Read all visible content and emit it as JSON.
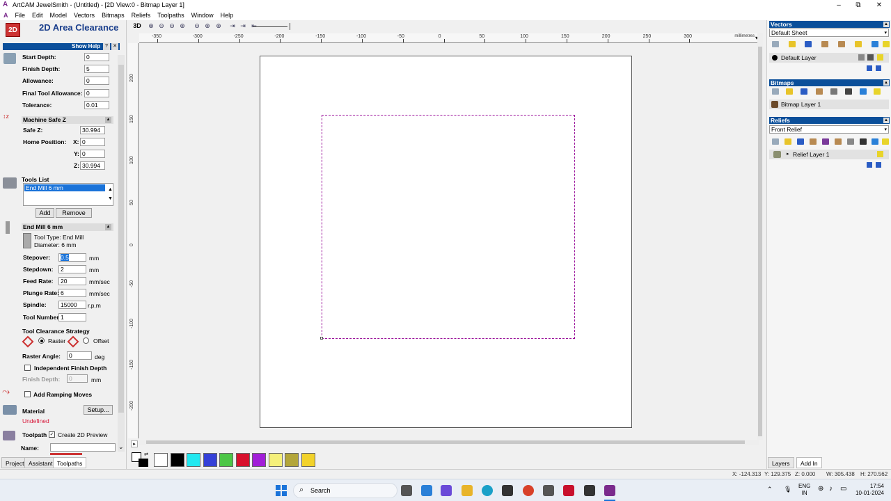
{
  "window": {
    "title": "ArtCAM JewelSmith - (Untitled) - [2D View:0 - Bitmap Layer 1]",
    "minimize": "–",
    "maximize": "⧉",
    "close": "✕"
  },
  "menu": [
    "File",
    "Edit",
    "Model",
    "Vectors",
    "Bitmaps",
    "Reliefs",
    "Toolpaths",
    "Window",
    "Help"
  ],
  "panel": {
    "title": "2D Area Clearance",
    "show_help": "Show Help",
    "start_depth_label": "Start Depth:",
    "start_depth": "0",
    "finish_depth_label": "Finish Depth:",
    "finish_depth": "5",
    "allowance_label": "Allowance:",
    "allowance": "0",
    "final_tool_allowance_label": "Final Tool Allowance:",
    "final_tool_allowance": "0",
    "tolerance_label": "Tolerance:",
    "tolerance": "0.01",
    "machine_safe_z_header": "Machine Safe Z",
    "safe_z_label": "Safe Z:",
    "safe_z": "30.994",
    "home_position_label": "Home Position:",
    "home_x_label": "X:",
    "home_x": "0",
    "home_y_label": "Y:",
    "home_y": "0",
    "home_z_label": "Z:",
    "home_z": "30.994",
    "tools_list_label": "Tools List",
    "tools": [
      "End Mill 6 mm"
    ],
    "add": "Add",
    "remove": "Remove",
    "tool_header": "End Mill 6 mm",
    "tool_type": "Tool Type: End Mill",
    "diameter": "Diameter: 6 mm",
    "stepover_label": "Stepover:",
    "stepover": "0.5",
    "stepover_unit": "mm",
    "stepdown_label": "Stepdown:",
    "stepdown": "2",
    "stepdown_unit": "mm",
    "feed_rate_label": "Feed Rate:",
    "feed_rate": "20",
    "feed_rate_unit": "mm/sec",
    "plunge_rate_label": "Plunge Rate:",
    "plunge_rate": "6",
    "plunge_rate_unit": "mm/sec",
    "spindle_label": "Spindle:",
    "spindle": "15000",
    "spindle_unit": "r.p.m",
    "tool_number_label": "Tool Number:",
    "tool_number": "1",
    "strategy_label": "Tool Clearance Strategy",
    "raster": "Raster",
    "offset": "Offset",
    "raster_angle_label": "Raster Angle:",
    "raster_angle": "0",
    "raster_angle_unit": "deg",
    "independent_finish_depth": "Independent Finish Depth",
    "finish_depth2_label": "Finish Depth:",
    "finish_depth2": "0",
    "finish_depth2_unit": "mm",
    "add_ramping_moves": "Add Ramping Moves",
    "material_label": "Material",
    "setup": "Setup...",
    "material_value": "Undefined",
    "toolpath_label": "Toolpath",
    "create_2d_preview": "Create 2D Preview",
    "name_label": "Name:",
    "name_value": ""
  },
  "bottom_tabs": [
    "Project",
    "Assistant",
    "Toolpaths"
  ],
  "toolbar": {
    "view3d": "3D"
  },
  "ruler": {
    "units": "millimetres",
    "h_labels": [
      "-350",
      "-300",
      "-250",
      "-200",
      "-150",
      "-100",
      "-50",
      "0",
      "50",
      "100",
      "150",
      "200",
      "250",
      "300"
    ],
    "v_labels": [
      "200",
      "150",
      "100",
      "50",
      "0",
      "-50",
      "-100",
      "-150",
      "-200"
    ]
  },
  "colors": [
    "#ffffff",
    "#000000",
    "#22e8f0",
    "#3540d8",
    "#4cc646",
    "#d8102c",
    "#a21ed8",
    "#f5f07a",
    "#b3a63a",
    "#f2d22a"
  ],
  "right": {
    "vectors_title": "Vectors",
    "vectors_sheet": "Default Sheet",
    "vectors_layer": "Default Layer",
    "bitmaps_title": "Bitmaps",
    "bitmap_layer": "Bitmap Layer 1",
    "reliefs_title": "Reliefs",
    "reliefs_sheet": "Front Relief",
    "relief_layer": "Relief Layer 1",
    "tab_layers": "Layers",
    "tab_addin": "Add In"
  },
  "status": {
    "x": "X: -124.313",
    "y": "Y: 129.375",
    "z": "Z: 0.000",
    "w": "W: 305.438",
    "h": "H: 270.562"
  },
  "taskbar": {
    "search": "Search",
    "lang1": "ENG",
    "lang2": "IN",
    "time": "17:54",
    "date": "10-01-2024"
  }
}
